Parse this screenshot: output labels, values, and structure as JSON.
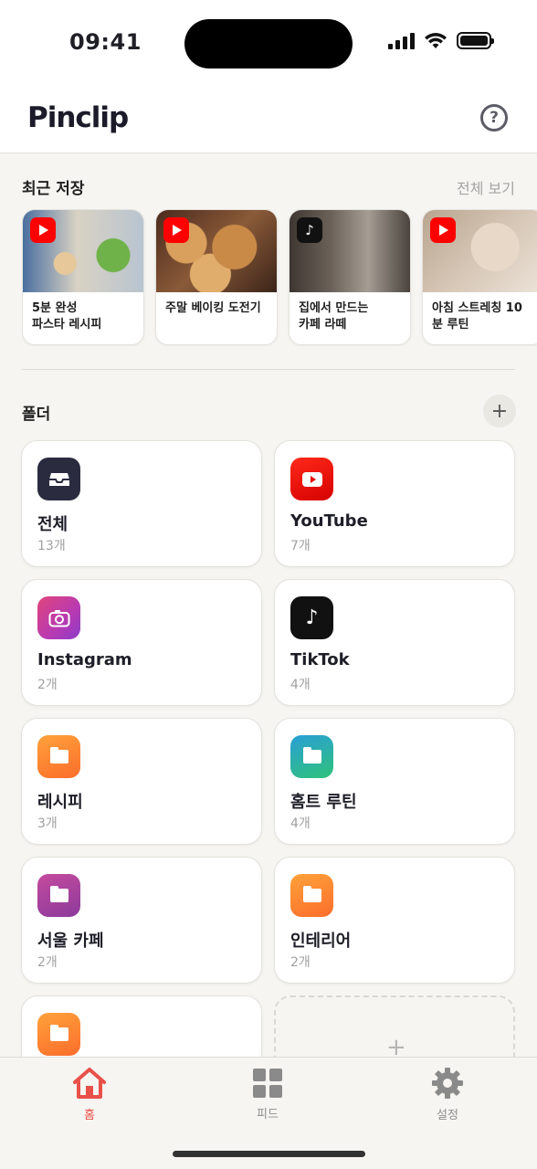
{
  "status_bar": {
    "time": "09:41"
  },
  "header": {
    "title": "Pinclip",
    "help_label": "?"
  },
  "recent": {
    "title": "최근 저장",
    "see_all": "전체 보기",
    "items": [
      {
        "title": "5분 완성\n파스타 레시피",
        "platform": "youtube",
        "badge_icon": "play-icon"
      },
      {
        "title": "주말 베이킹 도전기",
        "platform": "youtube",
        "badge_icon": "play-icon"
      },
      {
        "title": "집에서 만드는\n카페 라떼",
        "platform": "tiktok",
        "badge_icon": "music-note-icon"
      },
      {
        "title": "아침 스트레칭 10\n분 루틴",
        "platform": "youtube",
        "badge_icon": "play-icon"
      }
    ]
  },
  "folders": {
    "title": "폴더",
    "add_label": "+",
    "items": [
      {
        "name": "전체",
        "count": "13개",
        "icon": "inbox-tray-icon",
        "color": "#2b2b40"
      },
      {
        "name": "YouTube",
        "count": "7개",
        "icon": "youtube-icon",
        "color": "#f01010"
      },
      {
        "name": "Instagram",
        "count": "2개",
        "icon": "camera-icon",
        "color": "#c5358f"
      },
      {
        "name": "TikTok",
        "count": "4개",
        "icon": "music-note-icon",
        "color": "#111111"
      },
      {
        "name": "레시피",
        "count": "3개",
        "icon": "folder-icon",
        "color": "#fb7d2c"
      },
      {
        "name": "홈트 루틴",
        "count": "4개",
        "icon": "folder-icon",
        "color": "#21a89c"
      },
      {
        "name": "서울 카페",
        "count": "2개",
        "icon": "folder-icon",
        "color": "#a03d9a"
      },
      {
        "name": "인테리어",
        "count": "2개",
        "icon": "folder-icon",
        "color": "#fb7d2c"
      },
      {
        "name": "",
        "count": "",
        "icon": "folder-icon",
        "color": "#fb7d2c"
      }
    ],
    "new_folder_label": "+"
  },
  "tabs": [
    {
      "label": "홈",
      "icon": "home-icon",
      "active": true
    },
    {
      "label": "피드",
      "icon": "grid-icon",
      "active": false
    },
    {
      "label": "설정",
      "icon": "gear-icon",
      "active": false
    }
  ],
  "colors": {
    "accent": "#e9504a",
    "background": "#f6f5f1"
  }
}
